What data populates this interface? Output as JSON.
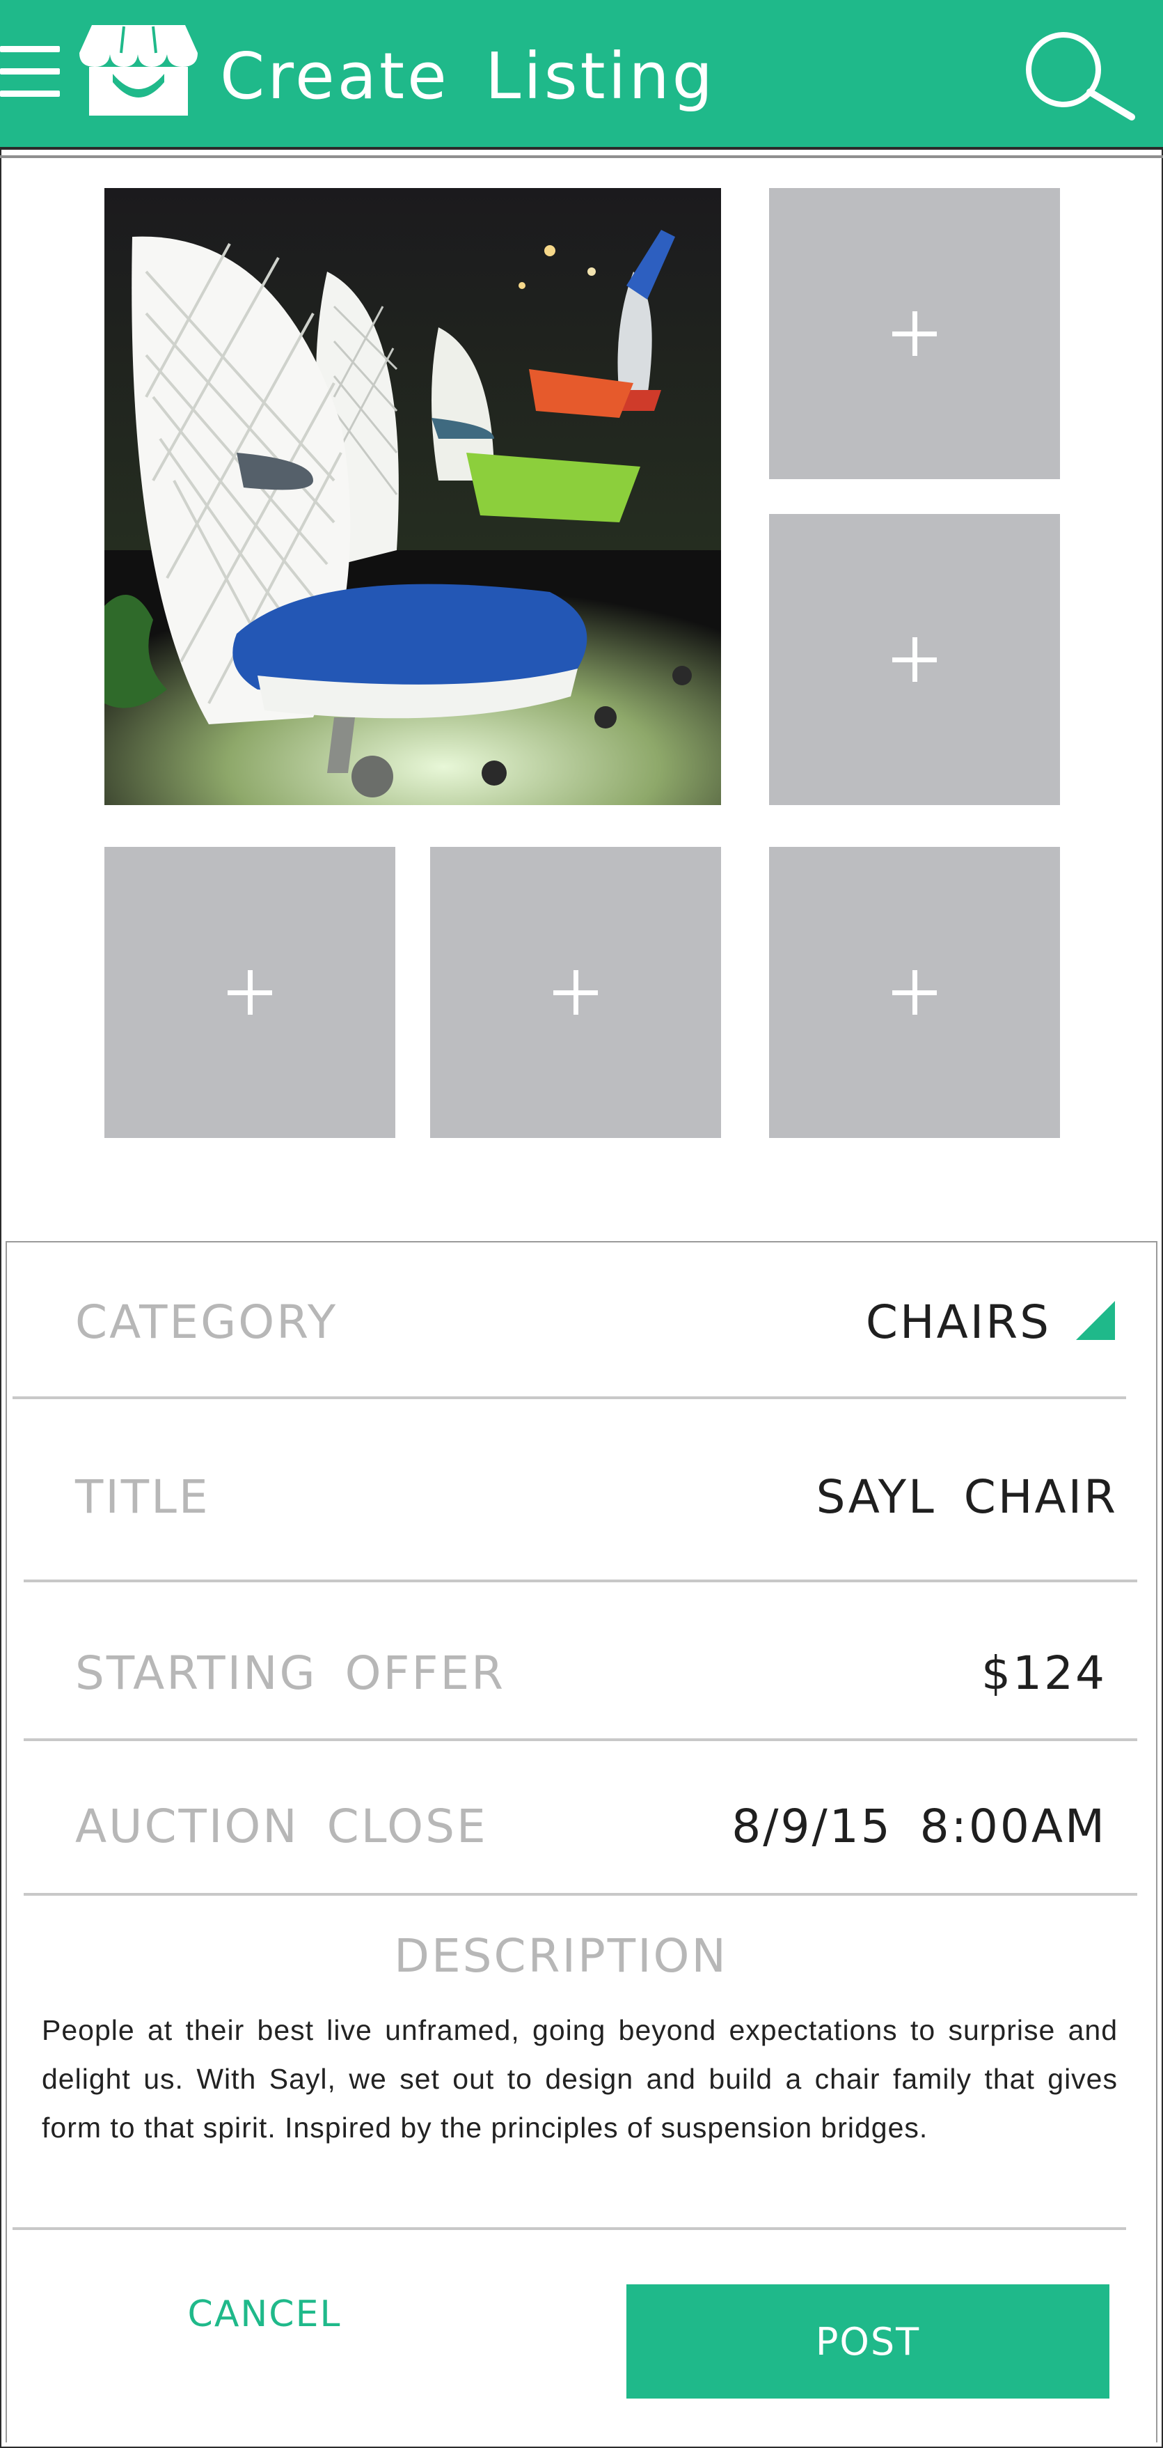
{
  "header": {
    "title": "Create Listing",
    "menu_icon": "hamburger-menu-icon",
    "logo_icon": "storefront-icon",
    "search_icon": "search-icon"
  },
  "photos": {
    "main_photo": "office-chairs-photo",
    "add_photo_symbol": "+",
    "empty_slot_count": 5
  },
  "form": {
    "category": {
      "label": "CATEGORY",
      "value": "CHAIRS"
    },
    "title": {
      "label": "TITLE",
      "value": "SAYL  CHAIR"
    },
    "starting_offer": {
      "label": "STARTING  OFFER",
      "value": "$124"
    },
    "auction_close": {
      "label": "AUCTION  CLOSE",
      "value": "8/9/15  8:00AM"
    },
    "description": {
      "label": "DESCRIPTION",
      "text": "People at their best live unframed, going beyond expectations to surprise and delight us. With Sayl, we set out to design and build a chair family that gives form to that spirit. Inspired by the principles of suspension bridges."
    }
  },
  "actions": {
    "cancel_label": "CANCEL",
    "post_label": "POST"
  },
  "colors": {
    "accent": "#1fb98a",
    "placeholder": "#bcbdc0",
    "label_gray": "#b7b7b7"
  }
}
